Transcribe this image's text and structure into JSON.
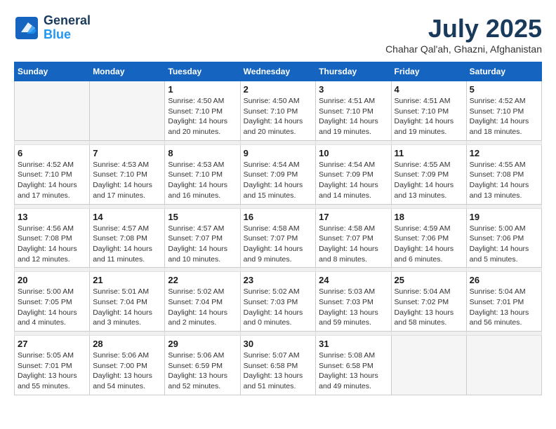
{
  "header": {
    "logo_line1": "General",
    "logo_line2": "Blue",
    "month_title": "July 2025",
    "location": "Chahar Qal'ah, Ghazni, Afghanistan"
  },
  "weekdays": [
    "Sunday",
    "Monday",
    "Tuesday",
    "Wednesday",
    "Thursday",
    "Friday",
    "Saturday"
  ],
  "weeks": [
    [
      {
        "day": "",
        "empty": true
      },
      {
        "day": "",
        "empty": true
      },
      {
        "day": "1",
        "sunrise": "4:50 AM",
        "sunset": "7:10 PM",
        "daylight": "14 hours and 20 minutes."
      },
      {
        "day": "2",
        "sunrise": "4:50 AM",
        "sunset": "7:10 PM",
        "daylight": "14 hours and 20 minutes."
      },
      {
        "day": "3",
        "sunrise": "4:51 AM",
        "sunset": "7:10 PM",
        "daylight": "14 hours and 19 minutes."
      },
      {
        "day": "4",
        "sunrise": "4:51 AM",
        "sunset": "7:10 PM",
        "daylight": "14 hours and 19 minutes."
      },
      {
        "day": "5",
        "sunrise": "4:52 AM",
        "sunset": "7:10 PM",
        "daylight": "14 hours and 18 minutes."
      }
    ],
    [
      {
        "day": "6",
        "sunrise": "4:52 AM",
        "sunset": "7:10 PM",
        "daylight": "14 hours and 17 minutes."
      },
      {
        "day": "7",
        "sunrise": "4:53 AM",
        "sunset": "7:10 PM",
        "daylight": "14 hours and 17 minutes."
      },
      {
        "day": "8",
        "sunrise": "4:53 AM",
        "sunset": "7:10 PM",
        "daylight": "14 hours and 16 minutes."
      },
      {
        "day": "9",
        "sunrise": "4:54 AM",
        "sunset": "7:09 PM",
        "daylight": "14 hours and 15 minutes."
      },
      {
        "day": "10",
        "sunrise": "4:54 AM",
        "sunset": "7:09 PM",
        "daylight": "14 hours and 14 minutes."
      },
      {
        "day": "11",
        "sunrise": "4:55 AM",
        "sunset": "7:09 PM",
        "daylight": "14 hours and 13 minutes."
      },
      {
        "day": "12",
        "sunrise": "4:55 AM",
        "sunset": "7:08 PM",
        "daylight": "14 hours and 13 minutes."
      }
    ],
    [
      {
        "day": "13",
        "sunrise": "4:56 AM",
        "sunset": "7:08 PM",
        "daylight": "14 hours and 12 minutes."
      },
      {
        "day": "14",
        "sunrise": "4:57 AM",
        "sunset": "7:08 PM",
        "daylight": "14 hours and 11 minutes."
      },
      {
        "day": "15",
        "sunrise": "4:57 AM",
        "sunset": "7:07 PM",
        "daylight": "14 hours and 10 minutes."
      },
      {
        "day": "16",
        "sunrise": "4:58 AM",
        "sunset": "7:07 PM",
        "daylight": "14 hours and 9 minutes."
      },
      {
        "day": "17",
        "sunrise": "4:58 AM",
        "sunset": "7:07 PM",
        "daylight": "14 hours and 8 minutes."
      },
      {
        "day": "18",
        "sunrise": "4:59 AM",
        "sunset": "7:06 PM",
        "daylight": "14 hours and 6 minutes."
      },
      {
        "day": "19",
        "sunrise": "5:00 AM",
        "sunset": "7:06 PM",
        "daylight": "14 hours and 5 minutes."
      }
    ],
    [
      {
        "day": "20",
        "sunrise": "5:00 AM",
        "sunset": "7:05 PM",
        "daylight": "14 hours and 4 minutes."
      },
      {
        "day": "21",
        "sunrise": "5:01 AM",
        "sunset": "7:04 PM",
        "daylight": "14 hours and 3 minutes."
      },
      {
        "day": "22",
        "sunrise": "5:02 AM",
        "sunset": "7:04 PM",
        "daylight": "14 hours and 2 minutes."
      },
      {
        "day": "23",
        "sunrise": "5:02 AM",
        "sunset": "7:03 PM",
        "daylight": "14 hours and 0 minutes."
      },
      {
        "day": "24",
        "sunrise": "5:03 AM",
        "sunset": "7:03 PM",
        "daylight": "13 hours and 59 minutes."
      },
      {
        "day": "25",
        "sunrise": "5:04 AM",
        "sunset": "7:02 PM",
        "daylight": "13 hours and 58 minutes."
      },
      {
        "day": "26",
        "sunrise": "5:04 AM",
        "sunset": "7:01 PM",
        "daylight": "13 hours and 56 minutes."
      }
    ],
    [
      {
        "day": "27",
        "sunrise": "5:05 AM",
        "sunset": "7:01 PM",
        "daylight": "13 hours and 55 minutes."
      },
      {
        "day": "28",
        "sunrise": "5:06 AM",
        "sunset": "7:00 PM",
        "daylight": "13 hours and 54 minutes."
      },
      {
        "day": "29",
        "sunrise": "5:06 AM",
        "sunset": "6:59 PM",
        "daylight": "13 hours and 52 minutes."
      },
      {
        "day": "30",
        "sunrise": "5:07 AM",
        "sunset": "6:58 PM",
        "daylight": "13 hours and 51 minutes."
      },
      {
        "day": "31",
        "sunrise": "5:08 AM",
        "sunset": "6:58 PM",
        "daylight": "13 hours and 49 minutes."
      },
      {
        "day": "",
        "empty": true
      },
      {
        "day": "",
        "empty": true
      }
    ]
  ]
}
